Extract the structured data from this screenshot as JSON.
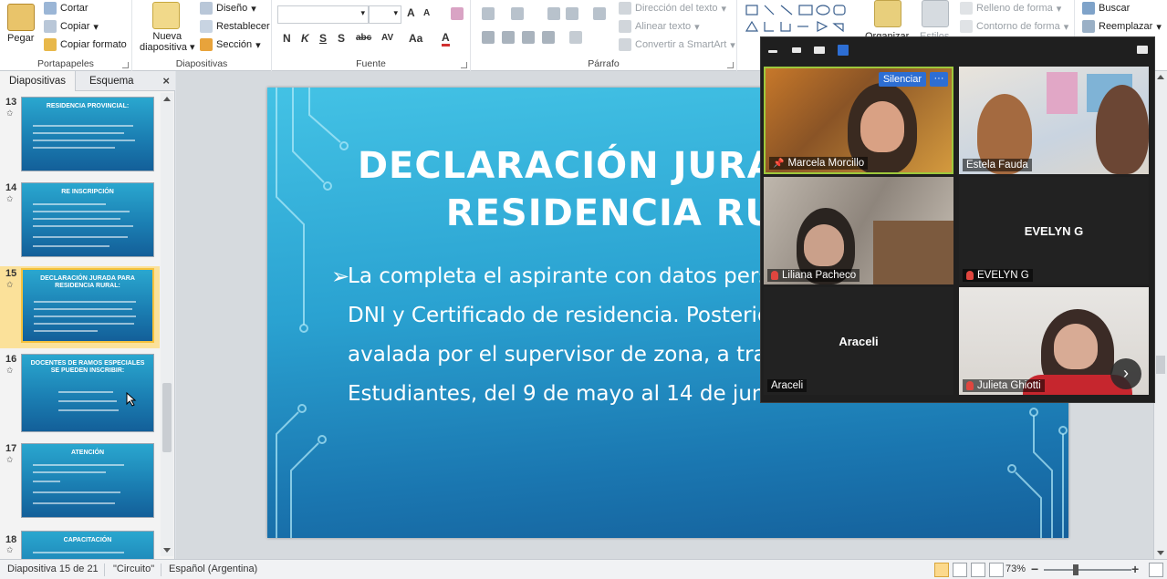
{
  "ribbon": {
    "clipboard": {
      "paste": "Pegar",
      "cut": "Cortar",
      "copy": "Copiar",
      "format_copy": "Copiar formato",
      "label": "Portapapeles"
    },
    "slides": {
      "new_slide_1": "Nueva",
      "new_slide_2": "diapositiva",
      "layout": "Diseño",
      "reset": "Restablecer",
      "section": "Sección",
      "label": "Diapositivas"
    },
    "font": {
      "bold": "N",
      "italic": "K",
      "underline": "S",
      "shadow": "S",
      "strike": "abc",
      "spacing": "AV",
      "case": "Aa",
      "color": "A",
      "grow": "A",
      "shrink": "A",
      "label": "Fuente"
    },
    "paragraph": {
      "text_direction": "Dirección del texto",
      "align_text": "Alinear texto",
      "smartart": "Convertir a SmartArt",
      "label": "Párrafo"
    },
    "drawing": {
      "organize": "Organizar",
      "styles": "Estilos",
      "fill": "Relleno de forma",
      "outline": "Contorno de forma"
    },
    "editing": {
      "find": "Buscar",
      "replace": "Reemplazar"
    }
  },
  "left_panel": {
    "tabs": [
      "Diapositivas",
      "Esquema"
    ],
    "close": "×",
    "thumbnails": [
      {
        "num": "13",
        "title": "RESIDENCIA PROVINCIAL:"
      },
      {
        "num": "14",
        "title": "RE INSCRIPCIÓN"
      },
      {
        "num": "15",
        "title": "DECLARACIÓN JURADA PARA RESIDENCIA RURAL:"
      },
      {
        "num": "16",
        "title": "DOCENTES DE RAMOS ESPECIALES SE PUEDEN INSCRIBIR:"
      },
      {
        "num": "17",
        "title": "ATENCIÓN"
      },
      {
        "num": "18",
        "title": "CAPACITACIÓN"
      }
    ],
    "star": "✩"
  },
  "slide": {
    "title_line1": "DECLARACIÓN JURADA PARA",
    "title_line2": "RESIDENCIA RURAL:",
    "bullet": "➢",
    "body": "La completa el aspirante con datos personales, se carga junto al DNI y Certificado de residencia. Posteriormente será cotejada y avalada por el supervisor de zona, a través de Gestión de Estudiantes, del 9 de mayo al 14 de junio del 2022."
  },
  "zoom": {
    "mute_label": "Silenciar",
    "more_label": "···",
    "next_label": "›",
    "participants": [
      {
        "name": "Marcela Morcillo",
        "muted": false,
        "pinned": true,
        "video": true
      },
      {
        "name": "Estela Fauda",
        "muted": false,
        "pinned": false,
        "video": true
      },
      {
        "name": "Liliana Pacheco",
        "muted": true,
        "pinned": false,
        "video": true
      },
      {
        "name": "EVELYN G",
        "muted": true,
        "pinned": false,
        "video": false,
        "display": "EVELYN G"
      },
      {
        "name": "Araceli",
        "muted": false,
        "pinned": false,
        "video": false,
        "display": "Araceli"
      },
      {
        "name": "Julieta Ghiotti",
        "muted": true,
        "pinned": false,
        "video": true
      }
    ]
  },
  "status": {
    "slide_info": "Diapositiva 15 de 21",
    "theme": "\"Circuito\"",
    "language": "Español (Argentina)",
    "zoom_level": "73%",
    "zoom_minus": "−",
    "zoom_plus": "+"
  },
  "colors": {
    "slide_top": "#43c2e5",
    "slide_bottom": "#15609b",
    "selected_thumb": "#f6c23b",
    "zoom_accent": "#2d6ed3",
    "active_speaker": "#9ec83c"
  }
}
